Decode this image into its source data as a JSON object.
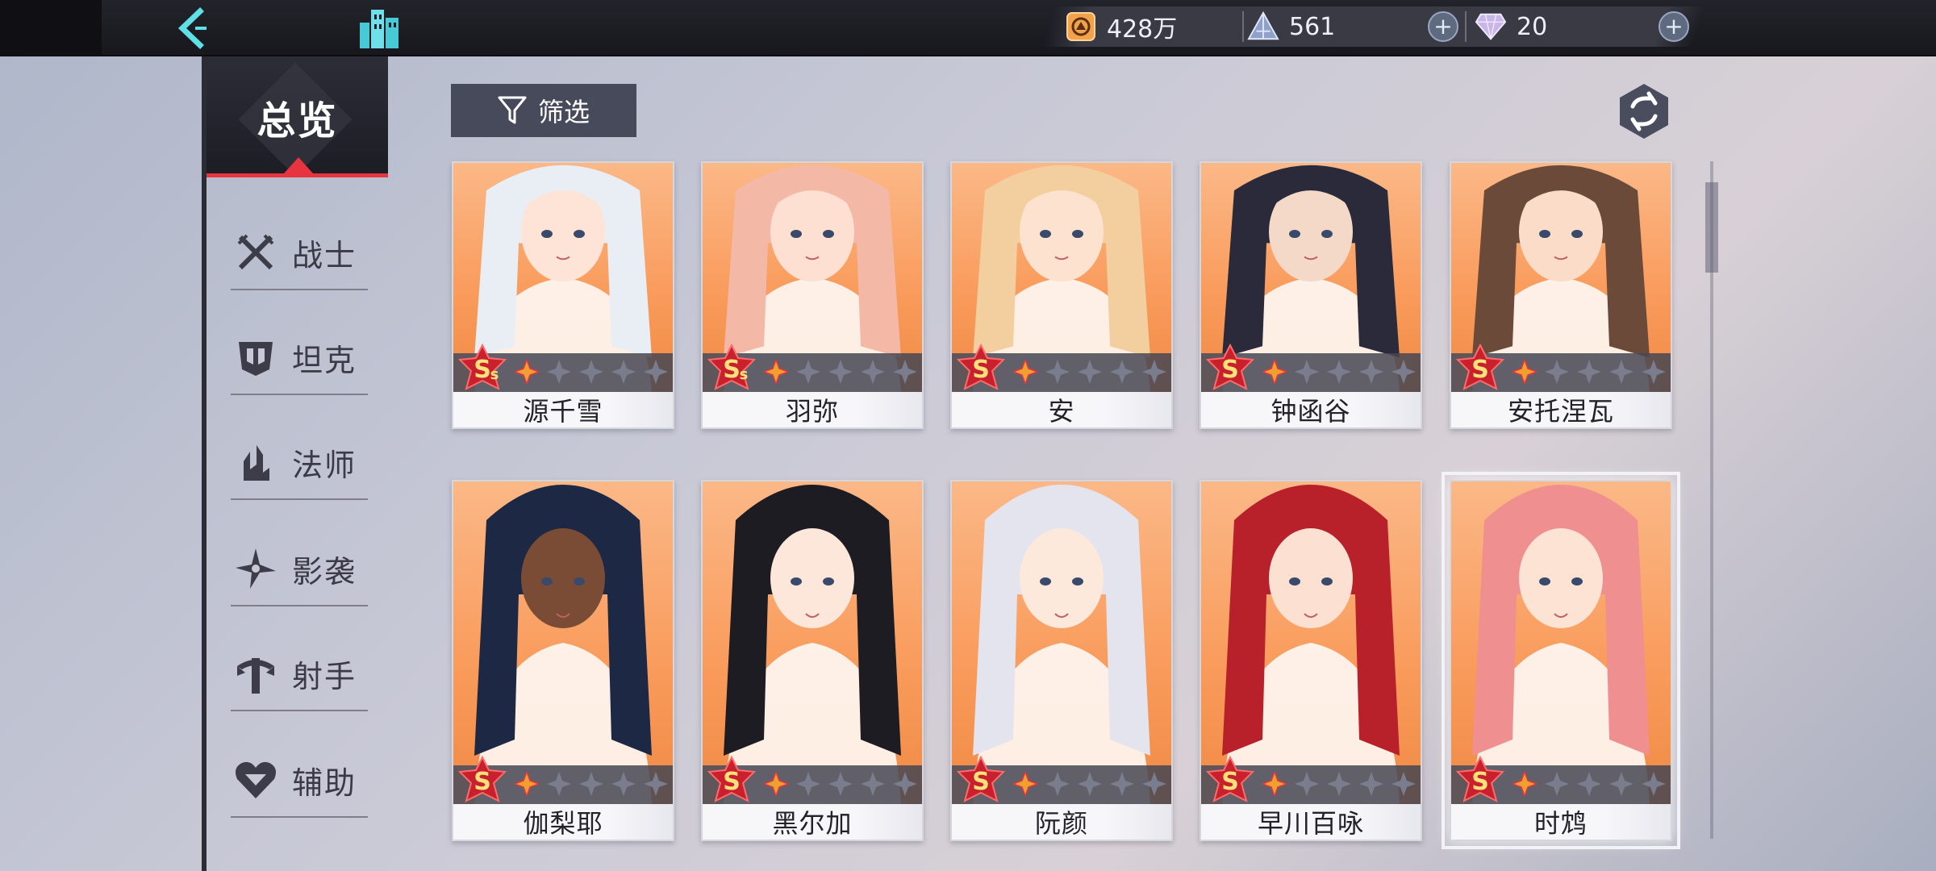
{
  "topbar": {
    "gold": "428万",
    "crystal": "561",
    "diamond": "20"
  },
  "sidebar": {
    "overview": "总览",
    "items": [
      {
        "label": "战士",
        "icon": "crossed-swords-icon"
      },
      {
        "label": "坦克",
        "icon": "shield-helmet-icon"
      },
      {
        "label": "法师",
        "icon": "mage-staff-icon"
      },
      {
        "label": "影袭",
        "icon": "shuriken-icon"
      },
      {
        "label": "射手",
        "icon": "bow-icon"
      },
      {
        "label": "辅助",
        "icon": "heart-icon"
      }
    ]
  },
  "filter": {
    "label": "筛选"
  },
  "colors": {
    "accent_red": "#e8343f",
    "card_orange": "#f99a5a",
    "topbar": "#1c1c23"
  },
  "cards": [
    {
      "name": "源千雪",
      "rank": "S",
      "rank_super": true,
      "stars_filled": 1,
      "stars_total": 5,
      "hair": "#e9eef5",
      "skin": "#fde4d6"
    },
    {
      "name": "羽弥",
      "rank": "S",
      "rank_super": true,
      "stars_filled": 1,
      "stars_total": 5,
      "hair": "#f4b8a6",
      "skin": "#fde0d2"
    },
    {
      "name": "安",
      "rank": "S",
      "rank_super": false,
      "stars_filled": 1,
      "stars_total": 5,
      "hair": "#f3cfa0",
      "skin": "#fde3cf"
    },
    {
      "name": "钟函谷",
      "rank": "S",
      "rank_super": false,
      "stars_filled": 1,
      "stars_total": 5,
      "hair": "#2a2a3a",
      "skin": "#f4d8c8"
    },
    {
      "name": "安托涅瓦",
      "rank": "S",
      "rank_super": false,
      "stars_filled": 1,
      "stars_total": 5,
      "hair": "#6b4a3a",
      "skin": "#fbdcc9"
    },
    {
      "name": "伽梨耶",
      "rank": "S",
      "rank_super": false,
      "stars_filled": 1,
      "stars_total": 5,
      "hair": "#1c2844",
      "skin": "#7a4c35"
    },
    {
      "name": "黑尔加",
      "rank": "S",
      "rank_super": false,
      "stars_filled": 1,
      "stars_total": 5,
      "hair": "#1c1c22",
      "skin": "#fde6da"
    },
    {
      "name": "阮颜",
      "rank": "S",
      "rank_super": false,
      "stars_filled": 1,
      "stars_total": 5,
      "hair": "#e4e4ee",
      "skin": "#fde8dc"
    },
    {
      "name": "早川百咏",
      "rank": "S",
      "rank_super": false,
      "stars_filled": 1,
      "stars_total": 5,
      "hair": "#b8202a",
      "skin": "#fce1d3"
    },
    {
      "name": "时鸩",
      "rank": "S",
      "rank_super": false,
      "stars_filled": 1,
      "stars_total": 5,
      "hair": "#ef8f8f",
      "skin": "#fde3d4",
      "selected": true
    }
  ]
}
